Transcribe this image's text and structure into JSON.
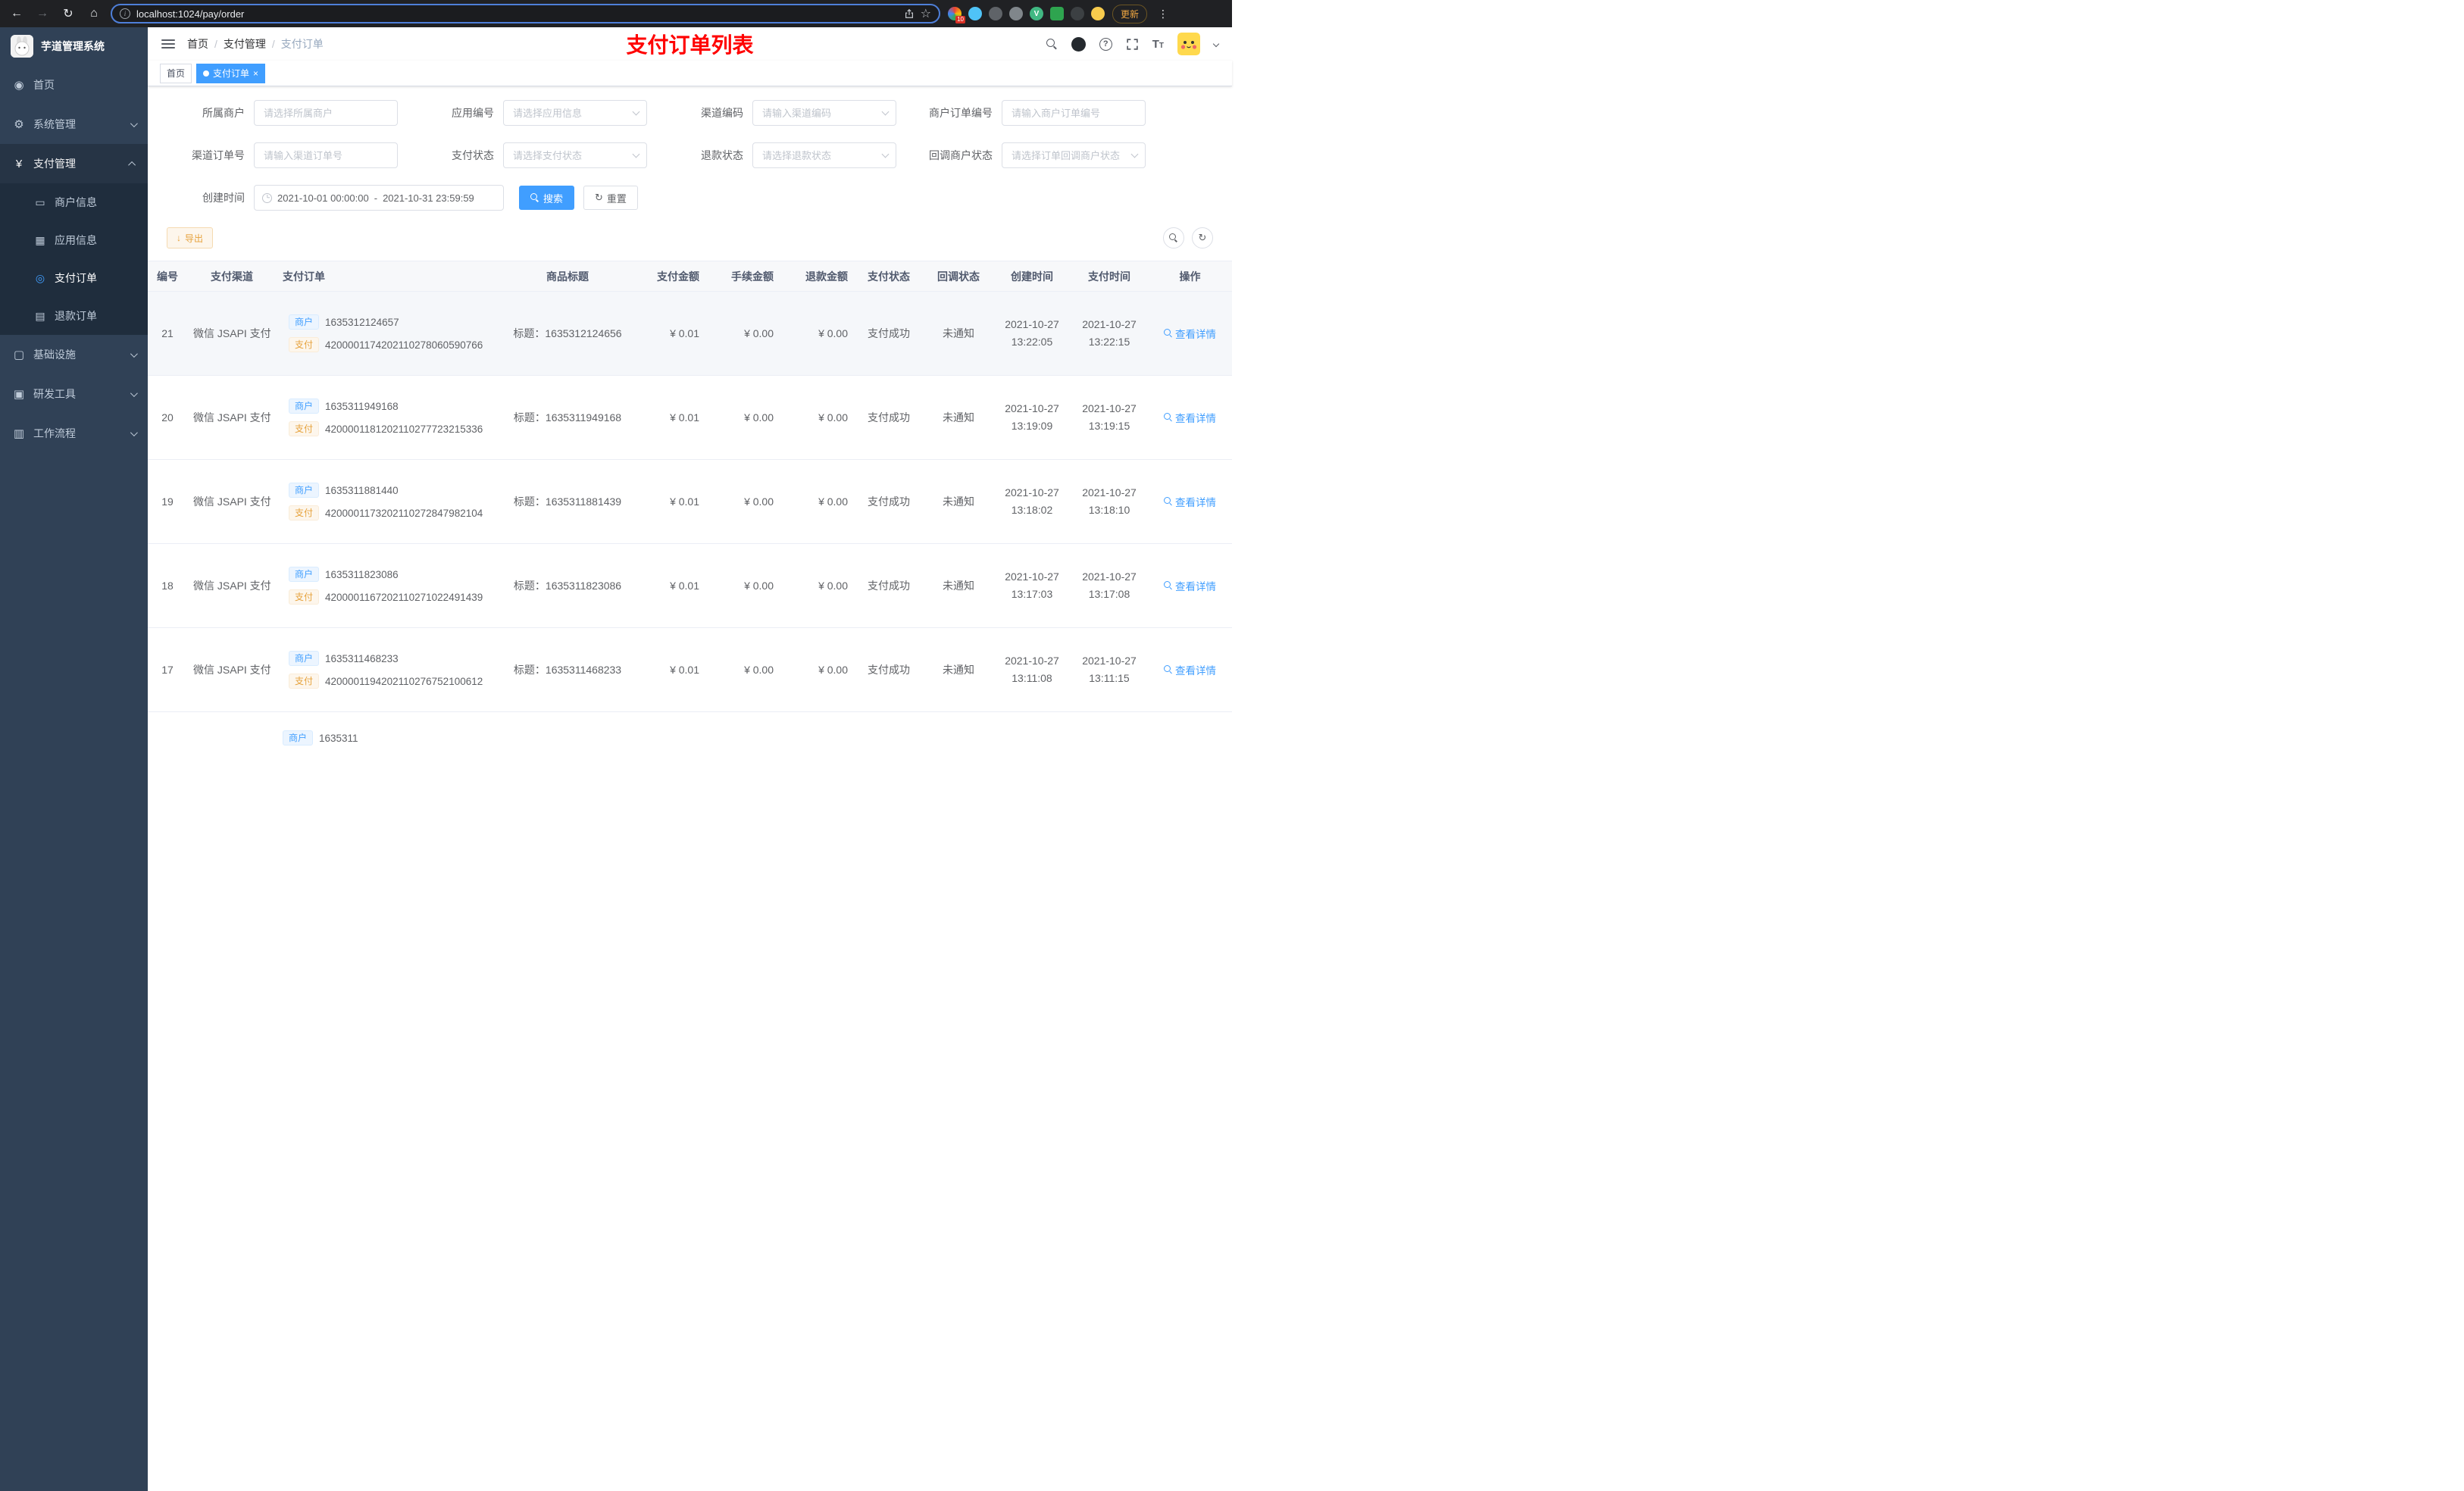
{
  "browser": {
    "url": "localhost:1024/pay/order",
    "update_button": "更新",
    "extension_badge": "10",
    "ext_v_letter": "V"
  },
  "header": {
    "breadcrumb": [
      "首页",
      "支付管理",
      "支付订单"
    ],
    "banner": "支付订单列表",
    "font_icon_big": "T",
    "font_icon_small": "T"
  },
  "tabs": [
    {
      "label": "首页"
    },
    {
      "label": "支付订单"
    }
  ],
  "sidebar": {
    "title": "芋道管理系统",
    "menu": [
      {
        "label": "首页"
      },
      {
        "label": "系统管理"
      },
      {
        "label": "支付管理"
      },
      {
        "label": "基础设施"
      },
      {
        "label": "研发工具"
      },
      {
        "label": "工作流程"
      }
    ],
    "submenu": [
      {
        "label": "商户信息"
      },
      {
        "label": "应用信息"
      },
      {
        "label": "支付订单"
      },
      {
        "label": "退款订单"
      }
    ],
    "icons": {
      "home": "◉",
      "system": "⚙",
      "pay": "¥",
      "merchant": "▭",
      "app": "▦",
      "order": "◎",
      "refund": "▤",
      "infra": "▢",
      "tools": "▣",
      "flow": "▥"
    }
  },
  "filters": {
    "fields": [
      {
        "label": "所属商户",
        "placeholder": "请选择所属商户"
      },
      {
        "label": "应用编号",
        "placeholder": "请选择应用信息"
      },
      {
        "label": "渠道编码",
        "placeholder": "请输入渠道编码"
      },
      {
        "label": "商户订单编号",
        "placeholder": "请输入商户订单编号"
      },
      {
        "label": "渠道订单号",
        "placeholder": "请输入渠道订单号"
      },
      {
        "label": "支付状态",
        "placeholder": "请选择支付状态"
      },
      {
        "label": "退款状态",
        "placeholder": "请选择退款状态"
      },
      {
        "label": "回调商户状态",
        "placeholder": "请选择订单回调商户状态"
      }
    ],
    "date": {
      "label": "创建时间",
      "start": "2021-10-01 00:00:00",
      "separator": "-",
      "end": "2021-10-31 23:59:59"
    },
    "search_button": "搜索",
    "reset_button": "重置",
    "reset_icon": "↻"
  },
  "toolbar": {
    "export_button": "导出",
    "export_icon": "↓",
    "refresh_icon": "↻"
  },
  "table": {
    "headers": [
      "编号",
      "支付渠道",
      "支付订单",
      "商品标题",
      "支付金额",
      "手续金额",
      "退款金额",
      "支付状态",
      "回调状态",
      "创建时间",
      "支付时间",
      "操作"
    ],
    "merchant_tag": "商户",
    "channel_tag": "支付",
    "action_label": "查看详情",
    "rows": [
      {
        "id": "21",
        "channel": "微信 JSAPI 支付",
        "merchant_no": "1635312124657",
        "channel_no": "4200001174202110278060590766",
        "title": "标题：1635312124656",
        "amount": "¥ 0.01",
        "fee": "¥ 0.00",
        "refund": "¥ 0.00",
        "status": "支付成功",
        "notify": "未通知",
        "create_date": "2021-10-27",
        "create_time": "13:22:05",
        "pay_date": "2021-10-27",
        "pay_time": "13:22:15"
      },
      {
        "id": "20",
        "channel": "微信 JSAPI 支付",
        "merchant_no": "1635311949168",
        "channel_no": "4200001181202110277723215336",
        "title": "标题：1635311949168",
        "amount": "¥ 0.01",
        "fee": "¥ 0.00",
        "refund": "¥ 0.00",
        "status": "支付成功",
        "notify": "未通知",
        "create_date": "2021-10-27",
        "create_time": "13:19:09",
        "pay_date": "2021-10-27",
        "pay_time": "13:19:15"
      },
      {
        "id": "19",
        "channel": "微信 JSAPI 支付",
        "merchant_no": "1635311881440",
        "channel_no": "4200001173202110272847982104",
        "title": "标题：1635311881439",
        "amount": "¥ 0.01",
        "fee": "¥ 0.00",
        "refund": "¥ 0.00",
        "status": "支付成功",
        "notify": "未通知",
        "create_date": "2021-10-27",
        "create_time": "13:18:02",
        "pay_date": "2021-10-27",
        "pay_time": "13:18:10"
      },
      {
        "id": "18",
        "channel": "微信 JSAPI 支付",
        "merchant_no": "1635311823086",
        "channel_no": "4200001167202110271022491439",
        "title": "标题：1635311823086",
        "amount": "¥ 0.01",
        "fee": "¥ 0.00",
        "refund": "¥ 0.00",
        "status": "支付成功",
        "notify": "未通知",
        "create_date": "2021-10-27",
        "create_time": "13:17:03",
        "pay_date": "2021-10-27",
        "pay_time": "13:17:08"
      },
      {
        "id": "17",
        "channel": "微信 JSAPI 支付",
        "merchant_no": "1635311468233",
        "channel_no": "4200001194202110276752100612",
        "title": "标题：1635311468233",
        "amount": "¥ 0.01",
        "fee": "¥ 0.00",
        "refund": "¥ 0.00",
        "status": "支付成功",
        "notify": "未通知",
        "create_date": "2021-10-27",
        "create_time": "13:11:08",
        "pay_date": "2021-10-27",
        "pay_time": "13:11:15"
      }
    ],
    "partial_row": {
      "merchant_no": "1635311"
    }
  }
}
